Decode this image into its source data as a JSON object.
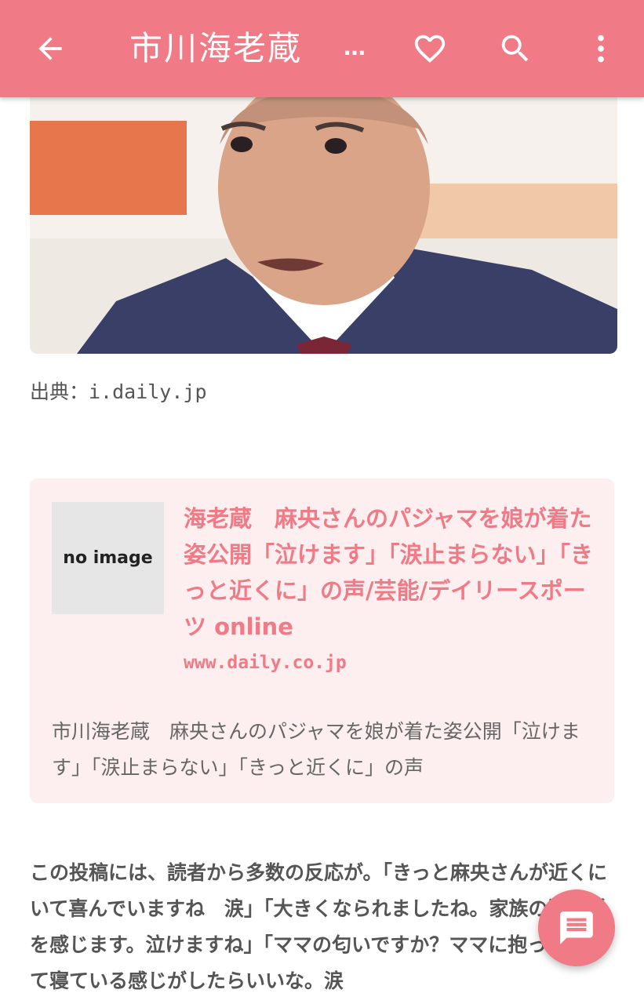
{
  "appbar": {
    "title": "市川海老蔵",
    "ellipsis": "…",
    "back_icon": "arrow-left-icon",
    "favorite_icon": "heart-outline-icon",
    "search_icon": "search-icon",
    "menu_icon": "more-vert-icon"
  },
  "article": {
    "image_caption": "出典：i.daily.jp"
  },
  "link_card": {
    "thumbnail_text": "no image",
    "title": "海老蔵　麻央さんのパジャマを娘が着た姿公開「泣けます」「涙止まらない」「きっと近くに」の声/芸能/デイリースポーツ online",
    "domain": "www.daily.co.jp",
    "description": "市川海老蔵　麻央さんのパジャマを娘が着た姿公開「泣けます」「涙止まらない」「きっと近くに」の声"
  },
  "body": {
    "paragraph": "この投稿には、読者から多数の反応が。「きっと麻央さんが近くにいて喜んでいますね　涙」「大きくなられましたね。家族の深い愛を感じます。泣けますね」「ママの匂いですか？ママに抱っこされて寝ている感じがしたらいいな。涙"
  },
  "fab": {
    "icon": "comment-icon"
  },
  "colors": {
    "accent": "#f07a85",
    "card_bg": "#fdeef0"
  }
}
